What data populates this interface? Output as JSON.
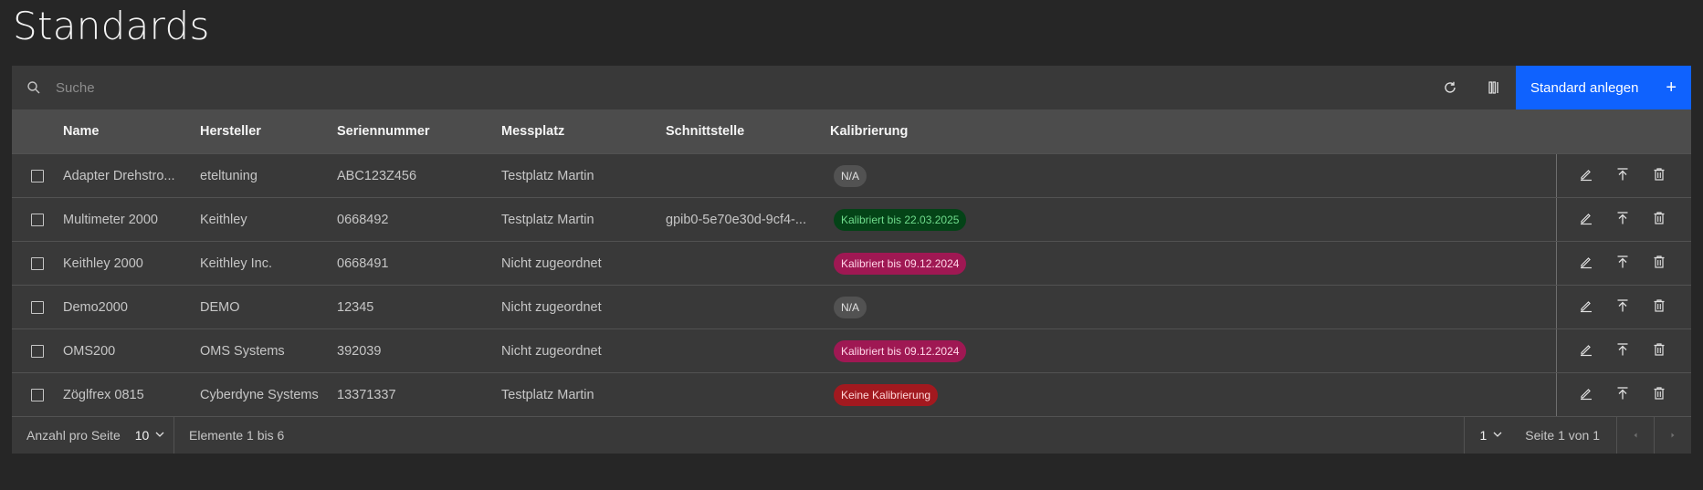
{
  "page": {
    "title": "Standards"
  },
  "toolbar": {
    "search_placeholder": "Suche",
    "search_value": "",
    "refresh_icon": "refresh-icon",
    "columns_icon": "columns-icon",
    "create_label": "Standard anlegen",
    "create_icon": "+"
  },
  "table": {
    "headers": {
      "name": "Name",
      "hersteller": "Hersteller",
      "seriennummer": "Seriennummer",
      "messplatz": "Messplatz",
      "schnittstelle": "Schnittstelle",
      "kalibrierung": "Kalibrierung"
    },
    "rows": [
      {
        "name": "Adapter Drehstro...",
        "hersteller": "eteltuning",
        "seriennummer": "ABC123Z456",
        "messplatz": "Testplatz Martin",
        "schnittstelle": "",
        "kalibrierung": "N/A",
        "status": "na"
      },
      {
        "name": "Multimeter 2000",
        "hersteller": "Keithley",
        "seriennummer": "0668492",
        "messplatz": "Testplatz Martin",
        "schnittstelle": "gpib0-5e70e30d-9cf4-...",
        "kalibrierung": "Kalibriert bis 22.03.2025",
        "status": "green"
      },
      {
        "name": "Keithley 2000",
        "hersteller": "Keithley Inc.",
        "seriennummer": "0668491",
        "messplatz": "Nicht zugeordnet",
        "schnittstelle": "",
        "kalibrierung": "Kalibriert bis 09.12.2024",
        "status": "pink"
      },
      {
        "name": "Demo2000",
        "hersteller": "DEMO",
        "seriennummer": "12345",
        "messplatz": "Nicht zugeordnet",
        "schnittstelle": "",
        "kalibrierung": "N/A",
        "status": "na"
      },
      {
        "name": "OMS200",
        "hersteller": "OMS Systems",
        "seriennummer": "392039",
        "messplatz": "Nicht zugeordnet",
        "schnittstelle": "",
        "kalibrierung": "Kalibriert bis 09.12.2024",
        "status": "pink"
      },
      {
        "name": "Zöglfrex 0815",
        "hersteller": "Cyberdyne Systems",
        "seriennummer": "13371337",
        "messplatz": "Testplatz Martin",
        "schnittstelle": "",
        "kalibrierung": "Keine Kalibrierung",
        "status": "red"
      }
    ],
    "row_actions": [
      "edit-icon",
      "upload-icon",
      "trash-icon"
    ]
  },
  "pagination": {
    "per_page_label": "Anzahl pro Seite",
    "per_page_value": "10",
    "items_text": "Elemente 1 bis 6",
    "page_value": "1",
    "page_of_text": "Seite 1 von 1"
  },
  "colors": {
    "background": "#262626",
    "primary": "#0f62fe",
    "tag_green": "#044317",
    "tag_pink": "#9f1853",
    "tag_red": "#a2191f",
    "tag_na": "#525252"
  }
}
